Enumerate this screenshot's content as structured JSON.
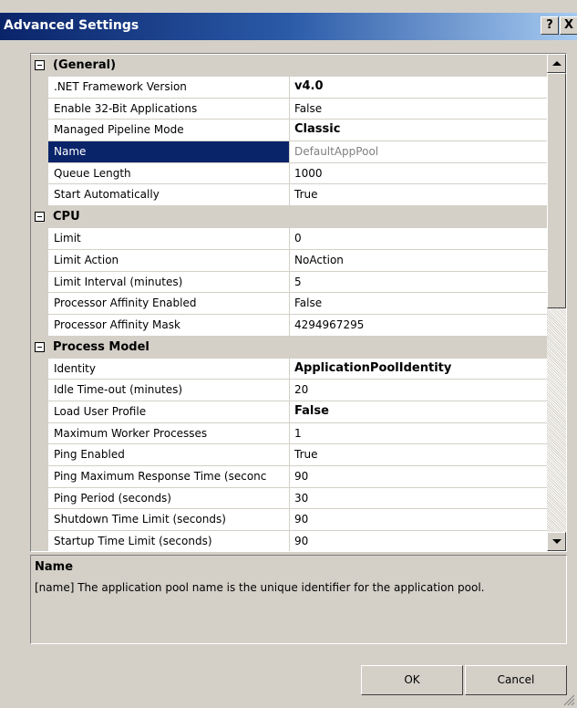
{
  "window": {
    "title": "Advanced Settings",
    "help_label": "?",
    "close_label": "X"
  },
  "grid": {
    "sections": [
      {
        "label": "(General)",
        "rows": [
          {
            "name": ".NET Framework Version",
            "value": "v4.0",
            "bold": true
          },
          {
            "name": "Enable 32-Bit Applications",
            "value": "False"
          },
          {
            "name": "Managed Pipeline Mode",
            "value": "Classic",
            "bold": true
          },
          {
            "name": "Name",
            "value": "DefaultAppPool",
            "selected": true
          },
          {
            "name": "Queue Length",
            "value": "1000"
          },
          {
            "name": "Start Automatically",
            "value": "True"
          }
        ]
      },
      {
        "label": "CPU",
        "rows": [
          {
            "name": "Limit",
            "value": "0"
          },
          {
            "name": "Limit Action",
            "value": "NoAction"
          },
          {
            "name": "Limit Interval (minutes)",
            "value": "5"
          },
          {
            "name": "Processor Affinity Enabled",
            "value": "False"
          },
          {
            "name": "Processor Affinity Mask",
            "value": "4294967295"
          }
        ]
      },
      {
        "label": "Process Model",
        "rows": [
          {
            "name": "Identity",
            "value": "ApplicationPoolIdentity",
            "bold": true
          },
          {
            "name": "Idle Time-out (minutes)",
            "value": "20"
          },
          {
            "name": "Load User Profile",
            "value": "False",
            "bold": true
          },
          {
            "name": "Maximum Worker Processes",
            "value": "1"
          },
          {
            "name": "Ping Enabled",
            "value": "True"
          },
          {
            "name": "Ping Maximum Response Time (seconc",
            "value": "90"
          },
          {
            "name": "Ping Period (seconds)",
            "value": "30"
          },
          {
            "name": "Shutdown Time Limit (seconds)",
            "value": "90"
          },
          {
            "name": "Startup Time Limit (seconds)",
            "value": "90"
          }
        ]
      }
    ]
  },
  "description": {
    "title": "Name",
    "text": "[name] The application pool name is the unique identifier for the application pool."
  },
  "buttons": {
    "ok": "OK",
    "cancel": "Cancel"
  },
  "colors": {
    "selection": "#0a246a",
    "dialog_face": "#d4d0c8"
  }
}
